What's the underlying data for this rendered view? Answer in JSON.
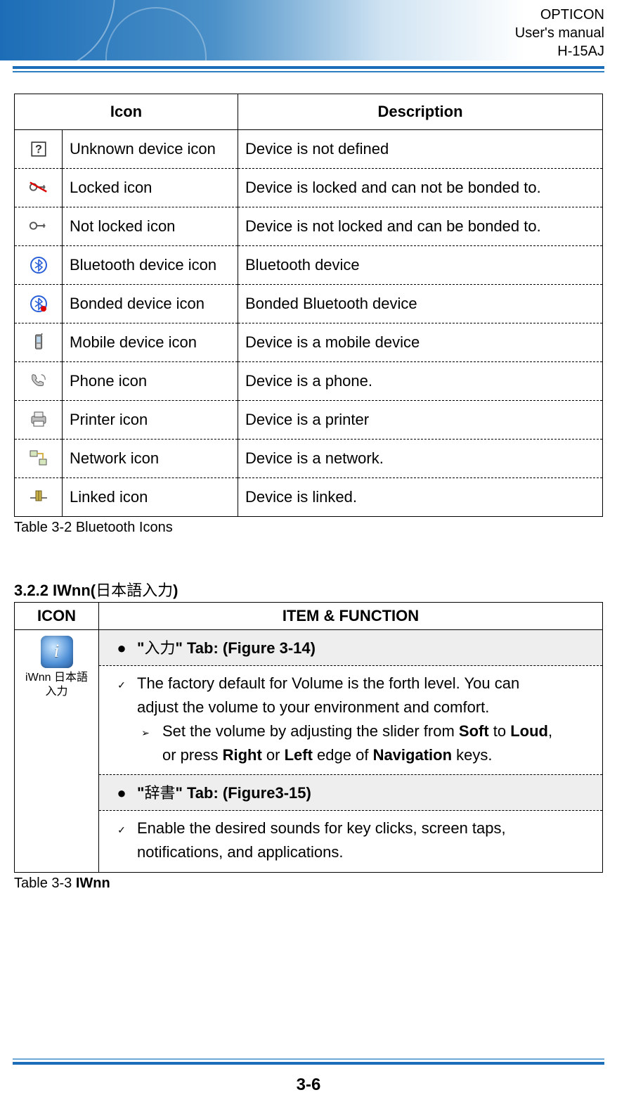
{
  "header": {
    "line1": "OPTICON",
    "line2": "User's manual",
    "line3": "H-15AJ"
  },
  "table32": {
    "headers": {
      "icon": "Icon",
      "desc": "Description"
    },
    "rows": [
      {
        "iconName": "unknown-device-icon",
        "label": "Unknown device icon",
        "desc": "Device is not defined"
      },
      {
        "iconName": "locked-icon",
        "label": "Locked icon",
        "desc": "Device is locked and can not be bonded to."
      },
      {
        "iconName": "not-locked-icon",
        "label": "Not locked icon",
        "desc": "Device is not locked and can be bonded to."
      },
      {
        "iconName": "bluetooth-device-icon",
        "label": "Bluetooth device icon",
        "desc": "Bluetooth device"
      },
      {
        "iconName": "bonded-device-icon",
        "label": "Bonded device icon",
        "desc": "Bonded Bluetooth device"
      },
      {
        "iconName": "mobile-device-icon",
        "label": "Mobile device icon",
        "desc": "Device is a mobile device"
      },
      {
        "iconName": "phone-icon",
        "label": "Phone icon",
        "desc": "Device is a phone."
      },
      {
        "iconName": "printer-icon",
        "label": "Printer icon",
        "desc": "Device is a printer"
      },
      {
        "iconName": "network-icon",
        "label": "Network icon",
        "desc": "Device is a network."
      },
      {
        "iconName": "linked-icon",
        "label": "Linked icon",
        "desc": "Device is linked."
      }
    ],
    "caption": "Table 3-2 Bluetooth Icons"
  },
  "section322": {
    "heading_prefix": "3.2.2 IWnn(",
    "heading_jp": "日本語入力",
    "heading_suffix": ")"
  },
  "table33": {
    "headers": {
      "icon": "ICON",
      "item": "ITEM & FUNCTION"
    },
    "appIcon": {
      "line1": "iWnn 日本語",
      "line2": "入力"
    },
    "tab1": {
      "prefix": "\"",
      "jp": "入力",
      "suffix": "\" Tab: (Figure 3-14)"
    },
    "body1_line1": "The factory default for Volume is the forth level. You can",
    "body1_line2": "adjust the volume to your environment and comfort.",
    "body1_sub_p1": "Set the volume by adjusting the slider from ",
    "body1_sub_b1": "Soft",
    "body1_sub_p2": " to ",
    "body1_sub_b2": "Loud",
    "body1_sub_p3": ",",
    "body1_sub2_p1": "or press ",
    "body1_sub2_b1": "Right",
    "body1_sub2_p2": " or ",
    "body1_sub2_b2": "Left",
    "body1_sub2_p3": " edge of ",
    "body1_sub2_b3": "Navigation",
    "body1_sub2_p4": " keys.",
    "tab2": {
      "prefix": "\"",
      "jp": "辞書",
      "suffix": "\" Tab: (Figure3-15)"
    },
    "body2_line1": "Enable the desired sounds for key clicks, screen taps,",
    "body2_line2": "notifications, and applications.",
    "caption_prefix": "Table 3-3 ",
    "caption_bold": "IWnn"
  },
  "pageNumber": "3-6"
}
